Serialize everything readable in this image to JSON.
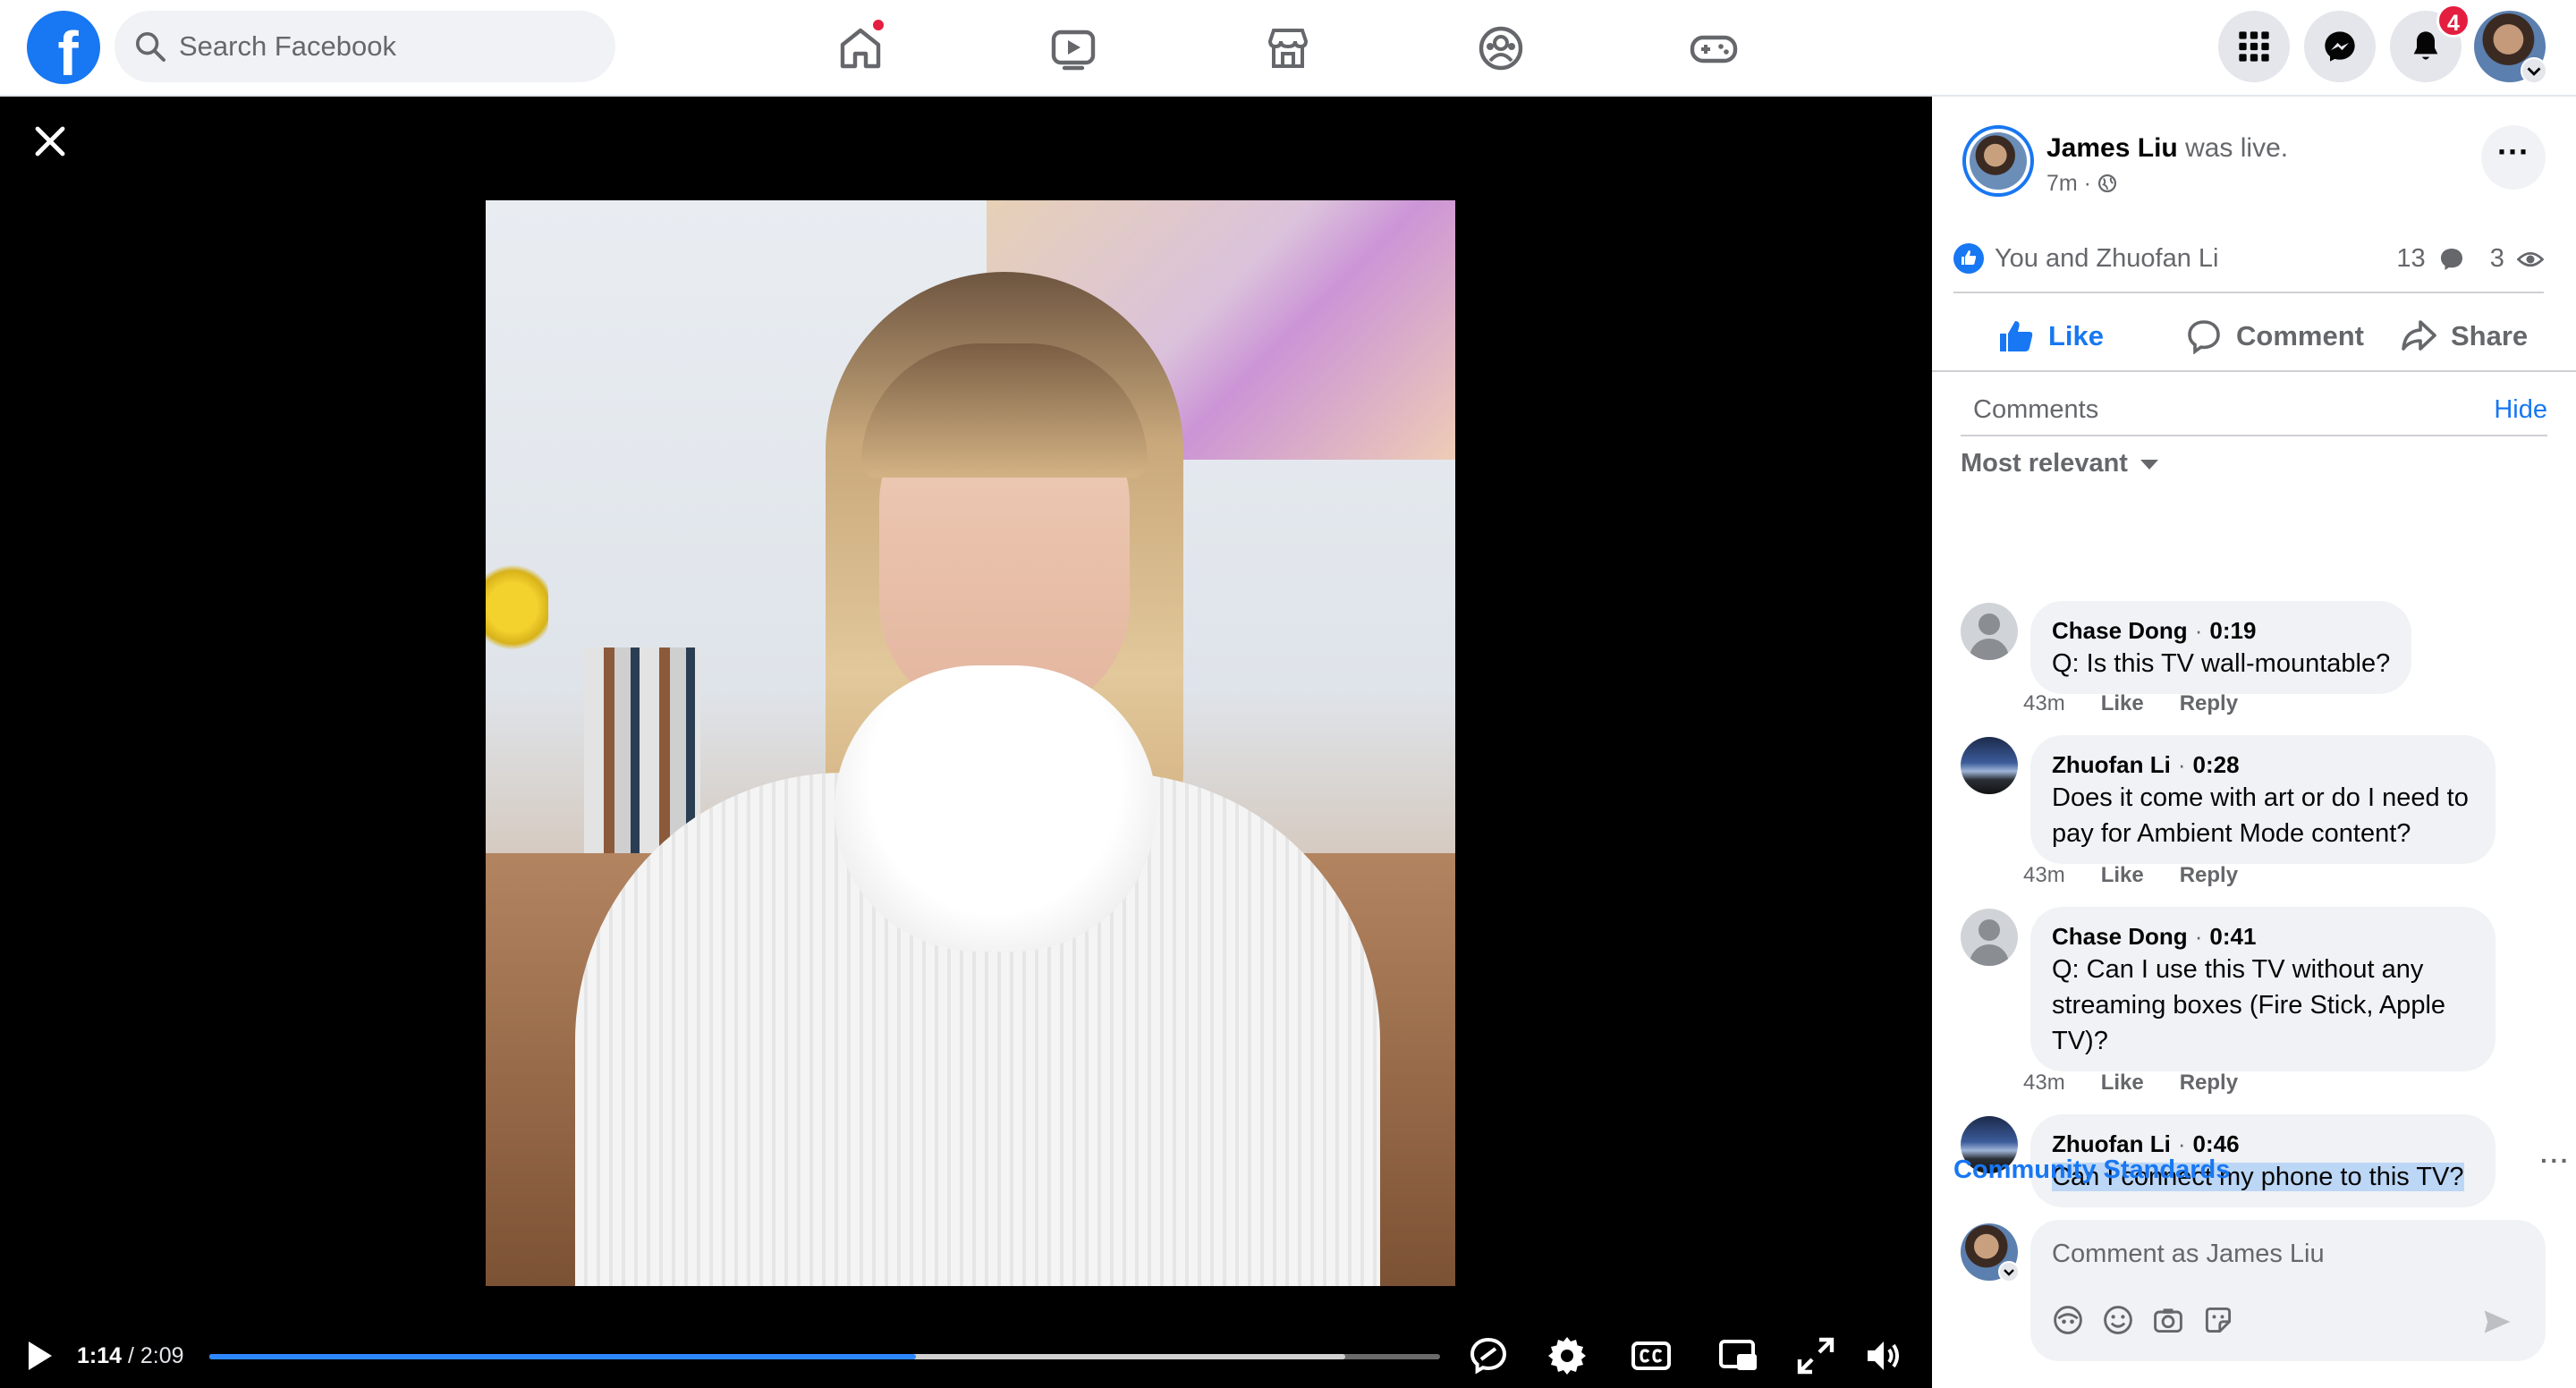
{
  "topbar": {
    "logo_letter": "f",
    "search_placeholder": "Search Facebook",
    "notifications_count": "4",
    "icons": [
      "home-icon",
      "watch-icon",
      "marketplace-icon",
      "groups-icon",
      "gaming-icon",
      "menu-grid-icon",
      "messenger-icon",
      "bell-icon"
    ]
  },
  "player": {
    "current_time": "1:14",
    "total_time": "2:09",
    "separator": " / ",
    "progress_fraction": 0.574,
    "buffered_fraction": 0.923,
    "accent_color": "#2d88ff"
  },
  "post": {
    "author": "James Liu",
    "status": "was live.",
    "time": "7m",
    "privacy_icon": "globe-icon",
    "reactions_text": "You and Zhuofan Li",
    "comment_count": "13",
    "view_count": "3",
    "actions": {
      "like": "Like",
      "comment": "Comment",
      "share": "Share"
    }
  },
  "comments": {
    "header": "Comments",
    "hide": "Hide",
    "sort": "Most relevant",
    "items": [
      {
        "name": "Chase Dong",
        "timestamp": "0:19",
        "text": "Q: Is this TV wall-mountable?",
        "age": "43m",
        "like": "Like",
        "reply": "Reply"
      },
      {
        "name": "Zhuofan Li",
        "timestamp": "0:28",
        "text": "Does it come with art or do I need to pay for Ambient Mode content?",
        "age": "43m",
        "like": "Like",
        "reply": "Reply"
      },
      {
        "name": "Chase Dong",
        "timestamp": "0:41",
        "text": "Q: Can I use this TV without any streaming boxes (Fire Stick, Apple TV)?",
        "age": "43m",
        "like": "Like",
        "reply": "Reply"
      },
      {
        "name": "Zhuofan Li",
        "timestamp": "0:46",
        "text": "Can I connect my phone to this TV?",
        "more": "···"
      }
    ],
    "community_standards": "Community Standards",
    "composer_placeholder": "Comment as James Liu"
  }
}
